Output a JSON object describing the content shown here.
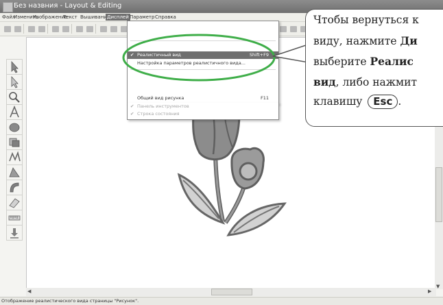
{
  "window": {
    "title": "Без назвния - Layout & Editing"
  },
  "menu": {
    "items": [
      {
        "label": "Файл"
      },
      {
        "label": "Изменить"
      },
      {
        "label": "Изображение"
      },
      {
        "label": "Текст"
      },
      {
        "label": "Вышивание"
      },
      {
        "label": "Дисплей"
      },
      {
        "label": "Параметр"
      },
      {
        "label": "Справка"
      }
    ]
  },
  "dropdown": {
    "items": [
      {
        "label": "Реалистичный вид",
        "shortcut": "Shift+F9",
        "checked": "✔"
      },
      {
        "label": "Настройка параметров реалистичного вида...",
        "shortcut": ""
      },
      {
        "label": "Общий вид рисунка",
        "shortcut": "F11"
      },
      {
        "label": "Панель инструментов",
        "checked": "✔"
      },
      {
        "label": "Строка состояния",
        "checked": "✔"
      }
    ],
    "highlight_color": "#6f6f6f"
  },
  "callout": {
    "line1": "Чтобы вернуться к",
    "line2_prefix": "виду, нажмите ",
    "line2_bold": "Ди",
    "line3_prefix": "выберите ",
    "line3_bold": "Реалис",
    "line4_bold": "вид",
    "line4_suffix": ", либо нажмит",
    "line5_prefix": "клавишу ",
    "line5_key": "Esc",
    "line5_suffix": "."
  },
  "status": {
    "text": "Отображение реалистического вида страницы \"Рисунок\"."
  },
  "colors": {
    "annotation_green": "#3fae49",
    "flower_petal": "#8c8c8c",
    "flower_outline": "#5f5f5f",
    "leaf_fill": "#d2d2d2",
    "leaf_outline": "#666666"
  },
  "icons": {
    "lefttools": [
      "select-arrow-icon",
      "point-edit-icon",
      "zoom-icon",
      "text-icon",
      "shape-icon",
      "fill-icon",
      "stitch-icon",
      "rectangle-icon",
      "outline-icon",
      "eraser-icon",
      "ruler-icon",
      "import-icon"
    ]
  }
}
